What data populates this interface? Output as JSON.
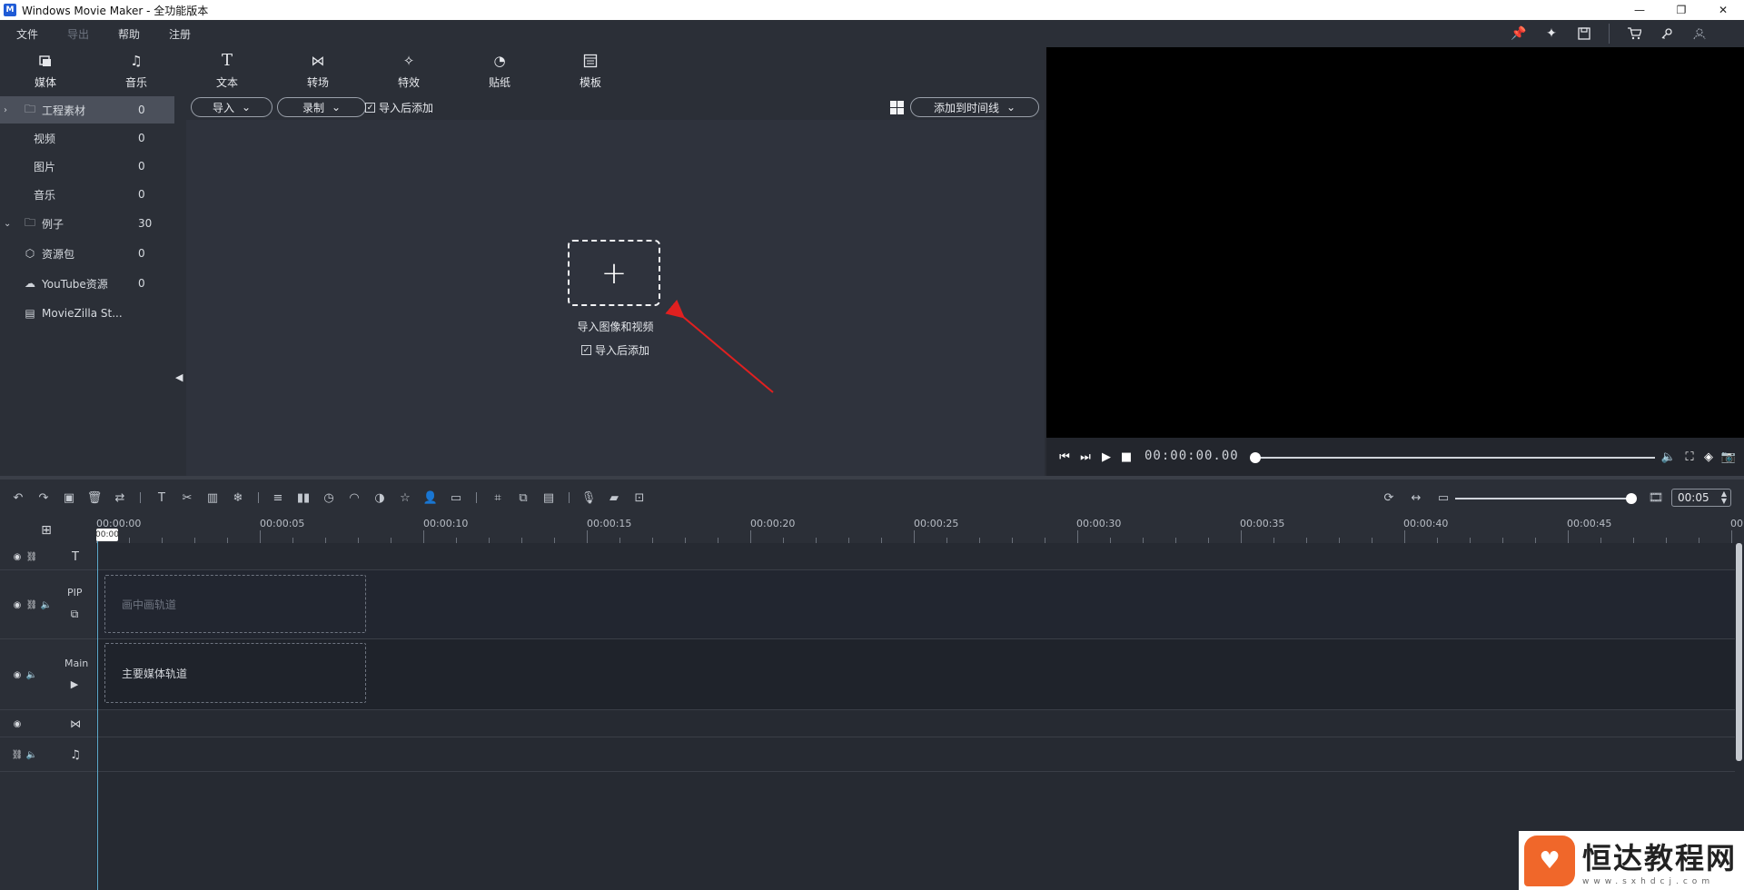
{
  "window": {
    "title": "Windows Movie Maker - 全功能版本",
    "app_icon": "M"
  },
  "menu": {
    "items": [
      {
        "label": "文件",
        "enabled": true
      },
      {
        "label": "导出",
        "enabled": false
      },
      {
        "label": "帮助",
        "enabled": true
      },
      {
        "label": "注册",
        "enabled": true
      }
    ],
    "right_icons": [
      "pin-icon",
      "star-icon",
      "save-icon",
      "cart-icon",
      "key-icon",
      "user-icon"
    ]
  },
  "tabs": [
    {
      "label": "媒体",
      "icon": "media-icon"
    },
    {
      "label": "音乐",
      "icon": "music-icon"
    },
    {
      "label": "文本",
      "icon": "text-icon"
    },
    {
      "label": "转场",
      "icon": "transition-icon"
    },
    {
      "label": "特效",
      "icon": "effects-icon"
    },
    {
      "label": "贴纸",
      "icon": "sticker-icon"
    },
    {
      "label": "模板",
      "icon": "template-icon"
    }
  ],
  "sidebar": {
    "items": [
      {
        "label": "工程素材",
        "count": "0",
        "icon": "folder-icon"
      },
      {
        "label": "视频",
        "count": "0"
      },
      {
        "label": "图片",
        "count": "0"
      },
      {
        "label": "音乐",
        "count": "0"
      },
      {
        "label": "例子",
        "count": "30",
        "icon": "folder-icon"
      },
      {
        "label": "资源包",
        "count": "0",
        "icon": "box-icon"
      },
      {
        "label": "YouTube资源",
        "count": "0",
        "icon": "cloud-icon"
      },
      {
        "label": "MovieZilla St...",
        "count": "",
        "icon": "store-icon"
      }
    ]
  },
  "media_toolbar": {
    "import_label": "导入",
    "record_label": "录制",
    "add_after_import": "导入后添加",
    "add_to_timeline": "添加到时间线"
  },
  "import_area": {
    "plus": "+",
    "label": "导入图像和视频",
    "checkbox_label": "导入后添加"
  },
  "player": {
    "timecode": "00:00:00.00"
  },
  "timeline_toolbar": {
    "zoom_value": "00:05"
  },
  "ruler": {
    "playhead_label": "00:00",
    "labels": [
      "00:00:00",
      "00:00:05",
      "00:00:10",
      "00:00:15",
      "00:00:20",
      "00:00:25",
      "00:00:30",
      "00:00:35",
      "00:00:40",
      "00:00:45",
      "00"
    ]
  },
  "tracks": {
    "pip_name": "PIP",
    "main_name": "Main",
    "pip_slot": "画中画轨道",
    "main_slot": "主要媒体轨道"
  },
  "watermark": {
    "title": "恒达教程网",
    "url": "www.sxhdcj.com"
  },
  "colors": {
    "accent_arrow": "#e02020",
    "playhead": "#5da8c9",
    "watermark_logo": "#f0672a"
  }
}
